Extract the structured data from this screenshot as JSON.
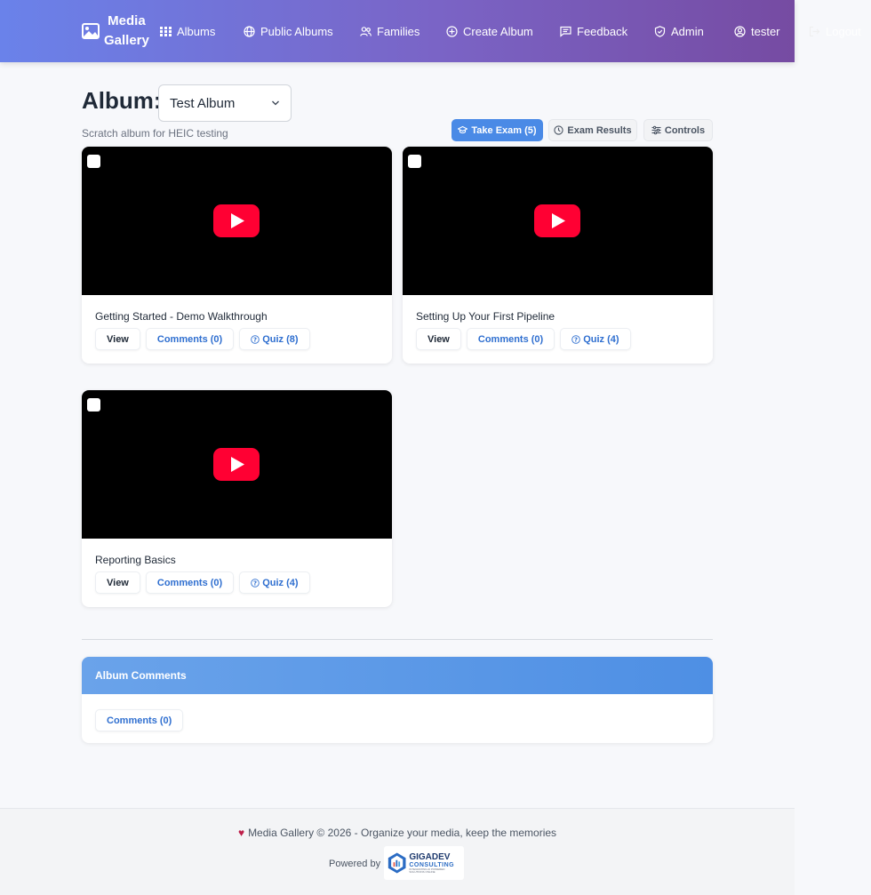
{
  "nav": {
    "brand_line1": "Media",
    "brand_line2": "Gallery",
    "items": [
      {
        "label": "Albums",
        "icon": "grid-icon"
      },
      {
        "label": "Public Albums",
        "icon": "globe-icon"
      },
      {
        "label": "Families",
        "icon": "users-icon"
      },
      {
        "label": "Create Album",
        "icon": "plus-circle-icon"
      },
      {
        "label": "Feedback",
        "icon": "message-icon"
      },
      {
        "label": "Admin",
        "icon": "shield-icon"
      },
      {
        "label": "tester",
        "icon": "user-circle-icon"
      },
      {
        "label": "Logout",
        "icon": "logout-icon"
      }
    ]
  },
  "album": {
    "heading": "Album:",
    "selected": "Test Album",
    "description": "Scratch album for HEIC testing"
  },
  "actions": {
    "take_exam": "Take Exam (5)",
    "exam_results": "Exam Results",
    "controls": "Controls"
  },
  "videos": [
    {
      "title": "Getting Started - Demo Walkthrough",
      "view": "View",
      "comments": "Comments (0)",
      "quiz": "Quiz (8)"
    },
    {
      "title": "Setting Up Your First Pipeline",
      "view": "View",
      "comments": "Comments (0)",
      "quiz": "Quiz (4)"
    },
    {
      "title": "Reporting Basics",
      "view": "View",
      "comments": "Comments (0)",
      "quiz": "Quiz (4)"
    }
  ],
  "album_comments": {
    "header": "Album Comments",
    "button": "Comments (0)"
  },
  "footer": {
    "text": "Media Gallery © 2026 - Organize your media, keep the memories",
    "powered_by": "Powered by",
    "logo_name": "GIGADEV",
    "logo_sub": "CONSULTING",
    "logo_tag": "INTEGRATING AI POWERED SOLUTIONS ONLINE"
  },
  "colors": {
    "nav_gradient_start": "#6a82ea",
    "nav_gradient_end": "#764ba2",
    "primary": "#4a8ae6",
    "youtube_red": "#ff0033"
  }
}
